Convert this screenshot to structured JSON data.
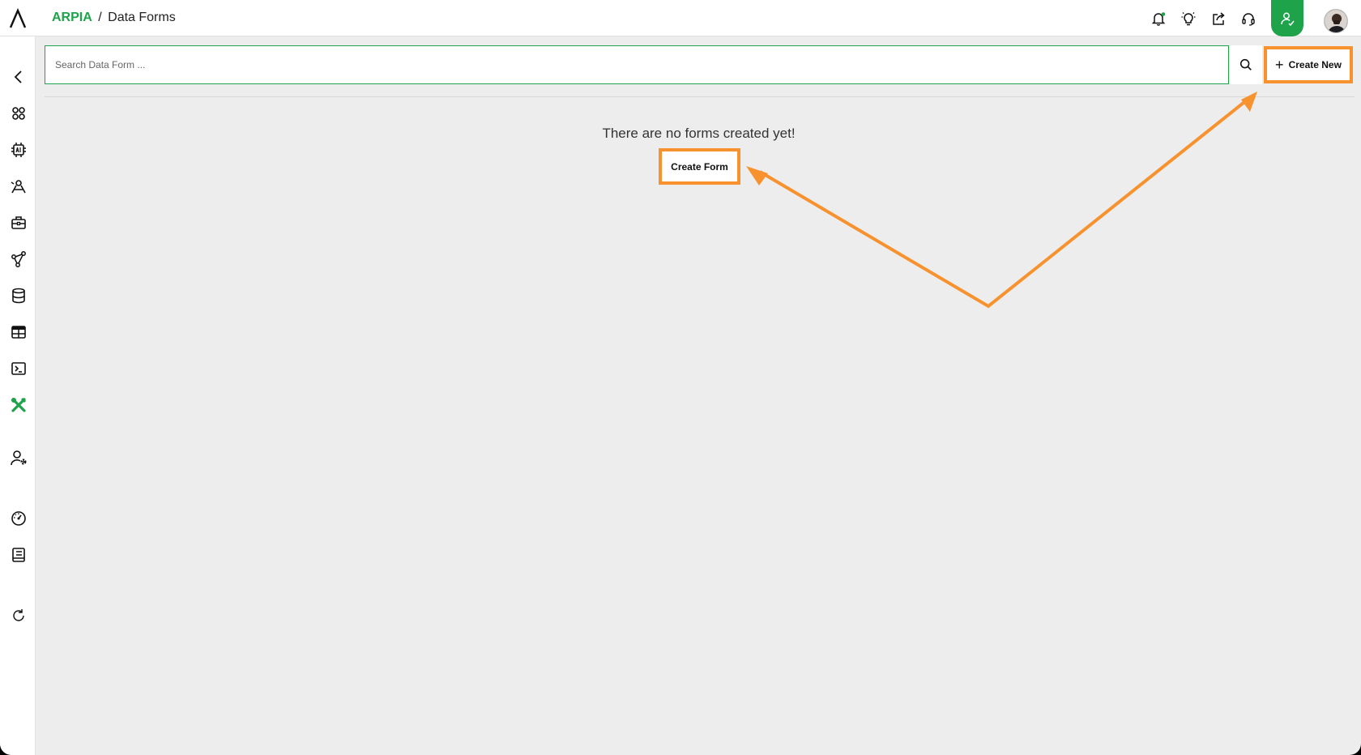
{
  "header": {
    "brand": "ARPIA",
    "separator": "/",
    "page": "Data Forms"
  },
  "top_icons": [
    "bell-icon",
    "lightbulb-icon",
    "share-icon",
    "headset-icon",
    "user-mode-icon",
    "avatar"
  ],
  "sidebar": {
    "items": [
      "back-icon",
      "apps-icon",
      "ai-chip-icon",
      "data-science-icon",
      "toolbox-icon",
      "pipeline-icon",
      "database-icon",
      "table-icon",
      "terminal-icon",
      "tools-icon",
      "user-settings-icon",
      "dashboard-icon",
      "notebook-icon",
      "refresh-icon"
    ],
    "active": "tools-icon"
  },
  "search": {
    "placeholder": "Search Data Form ...",
    "value": ""
  },
  "toolbar": {
    "create_new_label": "Create New"
  },
  "empty_state": {
    "message": "There are no forms created yet!",
    "create_label": "Create Form"
  },
  "colors": {
    "accent": "#1ea34a",
    "highlight": "#f7922f",
    "background": "#ededed"
  }
}
